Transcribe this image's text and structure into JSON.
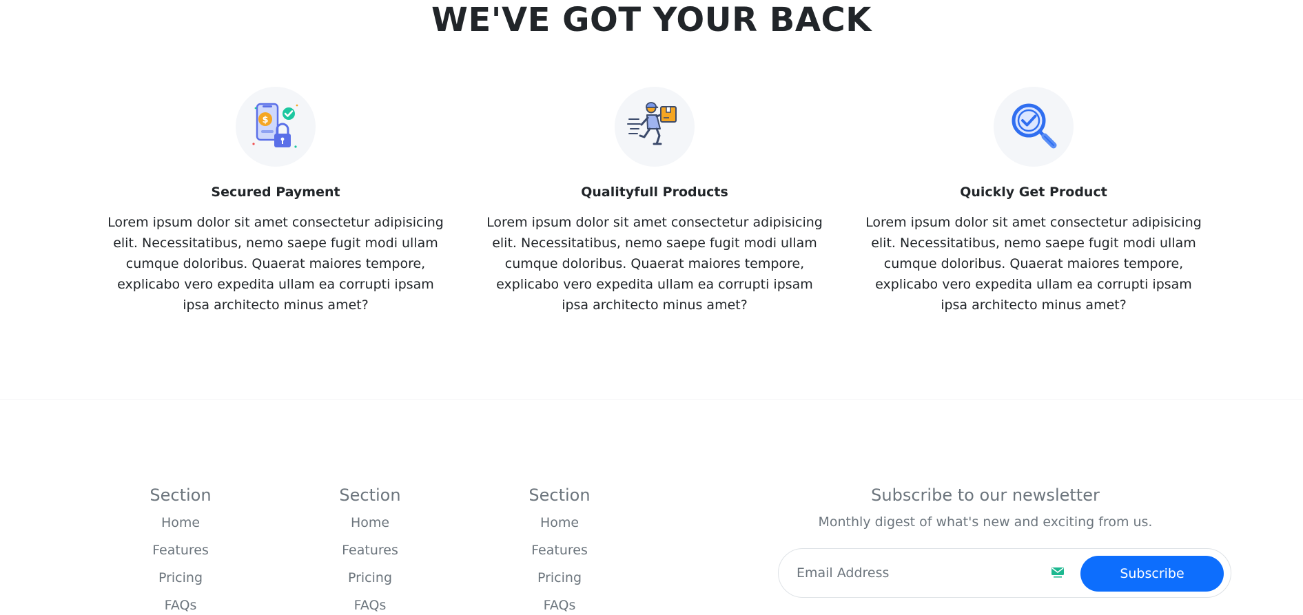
{
  "hero": {
    "title": "WE'VE GOT YOUR BACK"
  },
  "features": [
    {
      "icon": "secured-payment-icon",
      "title": "Secured Payment",
      "text": "Lorem ipsum dolor sit amet consectetur adipisicing elit. Necessitatibus, nemo saepe fugit modi ullam cumque doloribus. Quaerat maiores tempore, explicabo vero expedita ullam ea corrupti ipsam ipsa architecto minus amet?"
    },
    {
      "icon": "delivery-runner-icon",
      "title": "Qualityfull Products",
      "text": "Lorem ipsum dolor sit amet consectetur adipisicing elit. Necessitatibus, nemo saepe fugit modi ullam cumque doloribus. Quaerat maiores tempore, explicabo vero expedita ullam ea corrupti ipsam ipsa architecto minus amet?"
    },
    {
      "icon": "magnifier-check-icon",
      "title": "Quickly Get Product",
      "text": "Lorem ipsum dolor sit amet consectetur adipisicing elit. Necessitatibus, nemo saepe fugit modi ullam cumque doloribus. Quaerat maiores tempore, explicabo vero expedita ullam ea corrupti ipsam ipsa architecto minus amet?"
    }
  ],
  "footer": {
    "columns": [
      {
        "title": "Section",
        "links": [
          "Home",
          "Features",
          "Pricing",
          "FAQs"
        ]
      },
      {
        "title": "Section",
        "links": [
          "Home",
          "Features",
          "Pricing",
          "FAQs"
        ]
      },
      {
        "title": "Section",
        "links": [
          "Home",
          "Features",
          "Pricing",
          "FAQs"
        ]
      }
    ],
    "newsletter": {
      "title": "Subscribe to our newsletter",
      "subtitle": "Monthly digest of what's new and exciting from us.",
      "email_placeholder": "Email Address",
      "button_label": "Subscribe"
    }
  },
  "colors": {
    "primary": "#0d6efd",
    "muted_text": "#6c757d",
    "heading_text": "#212529",
    "icon_circle_bg": "#f4f6f9"
  }
}
